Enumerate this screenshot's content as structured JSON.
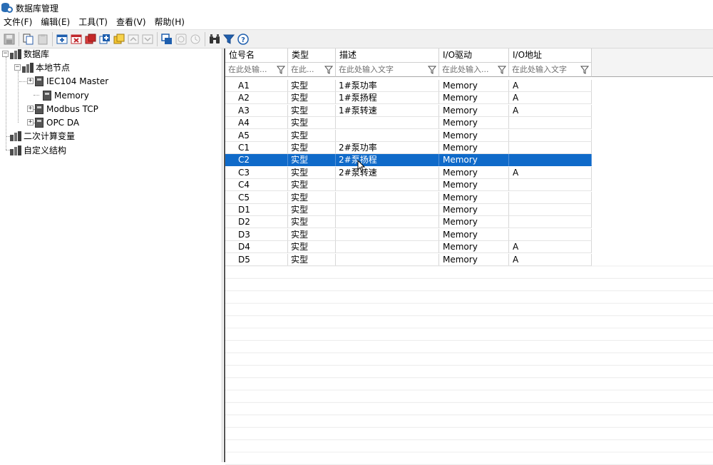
{
  "window": {
    "title": "数据库管理"
  },
  "menu": [
    "文件(F)",
    "编辑(E)",
    "工具(T)",
    "查看(V)",
    "帮助(H)"
  ],
  "toolbar": {
    "icons": [
      "save-icon",
      "copy-icon",
      "paste-icon",
      "add-icon",
      "delete-icon",
      "red-icon",
      "blue-add-icon",
      "yellow-icon",
      "move-up-icon",
      "move-down-icon",
      "window-icon",
      "history-icon",
      "clock-icon",
      "find-icon",
      "filter-icon",
      "help-icon"
    ]
  },
  "tree": {
    "root": "数据库",
    "local_node": "本地节点",
    "children": [
      "IEC104 Master",
      "Memory",
      "Modbus TCP",
      "OPC DA"
    ],
    "secondary": "二次计算变量",
    "custom": "自定义结构"
  },
  "grid": {
    "columns": [
      "位号名",
      "类型",
      "描述",
      "I/O驱动",
      "I/O地址"
    ],
    "filters": [
      "在此处输...",
      "在此...",
      "在此处输入文字",
      "在此处输入...",
      "在此处输入文字"
    ],
    "rows": [
      [
        "A1",
        "实型",
        "1#泵功率",
        "Memory",
        "A"
      ],
      [
        "A2",
        "实型",
        "1#泵扬程",
        "Memory",
        "A"
      ],
      [
        "A3",
        "实型",
        "1#泵转速",
        "Memory",
        "A"
      ],
      [
        "A4",
        "实型",
        "",
        "Memory",
        ""
      ],
      [
        "A5",
        "实型",
        "",
        "Memory",
        ""
      ],
      [
        "C1",
        "实型",
        "2#泵功率",
        "Memory",
        ""
      ],
      [
        "C2",
        "实型",
        "2#泵扬程",
        "Memory",
        ""
      ],
      [
        "C3",
        "实型",
        "2#泵转速",
        "Memory",
        "A"
      ],
      [
        "C4",
        "实型",
        "",
        "Memory",
        ""
      ],
      [
        "C5",
        "实型",
        "",
        "Memory",
        ""
      ],
      [
        "D1",
        "实型",
        "",
        "Memory",
        ""
      ],
      [
        "D2",
        "实型",
        "",
        "Memory",
        ""
      ],
      [
        "D3",
        "实型",
        "",
        "Memory",
        ""
      ],
      [
        "D4",
        "实型",
        "",
        "Memory",
        "A"
      ],
      [
        "D5",
        "实型",
        "",
        "Memory",
        "A"
      ]
    ],
    "selected_row": 6,
    "selection_color": "#0f6ac9"
  }
}
